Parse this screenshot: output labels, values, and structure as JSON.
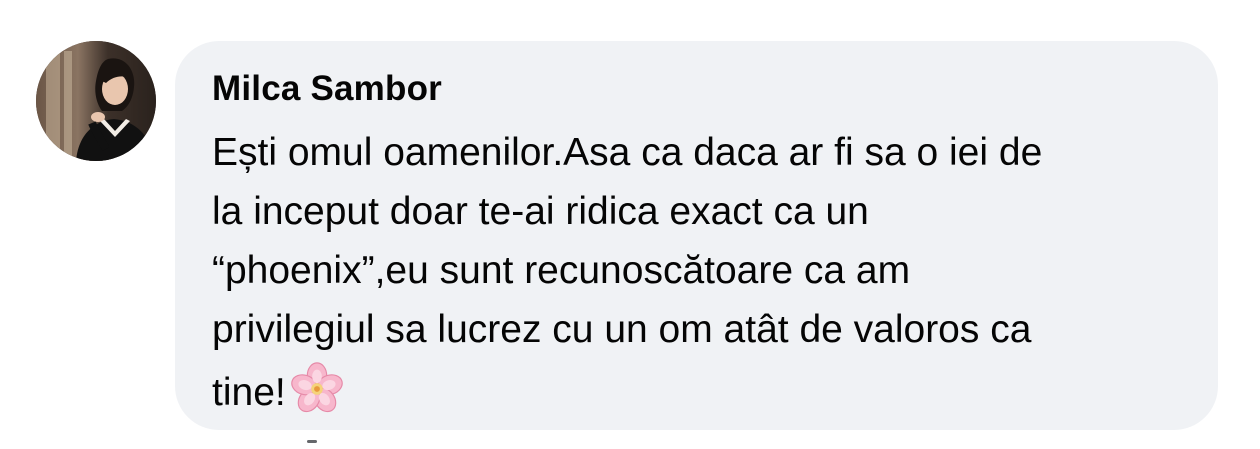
{
  "comment": {
    "author": "Milca Sambor",
    "lines": [
      "Ești omul oamenilor.Asa ca daca ar fi sa o iei de",
      "la inceput doar te-ai ridica exact ca un",
      "“phoenix”,eu sunt recunoscătoare ca am",
      "privilegiul sa lucrez cu un om atât de valoros ca",
      "tine!"
    ],
    "emoji": "cherry-blossom",
    "bubble_color": "#f0f2f5",
    "text_color": "#050505"
  }
}
